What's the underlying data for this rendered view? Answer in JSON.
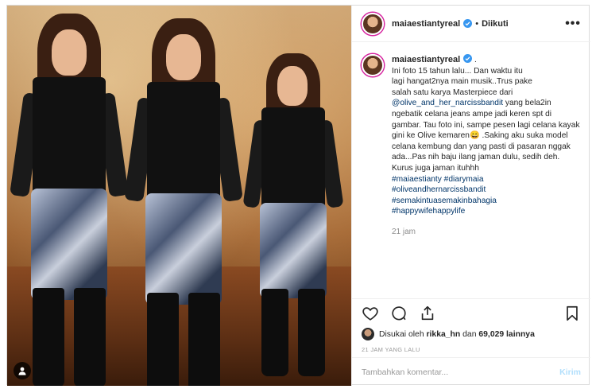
{
  "header": {
    "username": "maiaestiantyreal",
    "separator": "•",
    "follow_status": "Diikuti",
    "more_label": "•••"
  },
  "caption": {
    "username": "maiaestiantyreal",
    "trailing": " .",
    "lines": [
      "Ini foto 15 tahun lalu... Dan waktu itu",
      "lagi hangat2nya main musik..Trus pake",
      "salah satu karya Masterpiece dari"
    ],
    "mention": "@olive_and_her_narcissbandit",
    "after_mention": " yang bela2in ngebatik celana jeans ampe jadi keren spt di gambar. Tau foto ini, sampe pesen lagi celana kayak gini ke Olive kemaren",
    "emoji": "😄",
    "after_emoji": " .Saking aku suka model celana kembung dan yang pasti di pasaran nggak ada...Pas nih baju ilang jaman dulu, sedih deh. Kurus juga jaman ituhhh",
    "hashtags": [
      "#maiaestianty #diarymaia",
      "#oliveandhernarcissbandit",
      "#semakintuasemakinbahagia",
      "#happywifehappylife"
    ],
    "relative_time": "21 jam"
  },
  "likes": {
    "prefix": "Disukai oleh ",
    "user": "rikka_hn",
    "middle": " dan ",
    "count": "69,029 lainnya"
  },
  "date": "21 JAM YANG LALU",
  "comment": {
    "placeholder": "Tambahkan komentar...",
    "post_label": "Kirim"
  },
  "colors": {
    "link": "#003569",
    "muted": "#8e8e8e",
    "verified": "#3897f0",
    "post_button": "#b2dffc"
  },
  "icons": [
    "heart-icon",
    "comment-icon",
    "share-icon",
    "bookmark-icon",
    "verified-icon",
    "user-tag-icon"
  ]
}
